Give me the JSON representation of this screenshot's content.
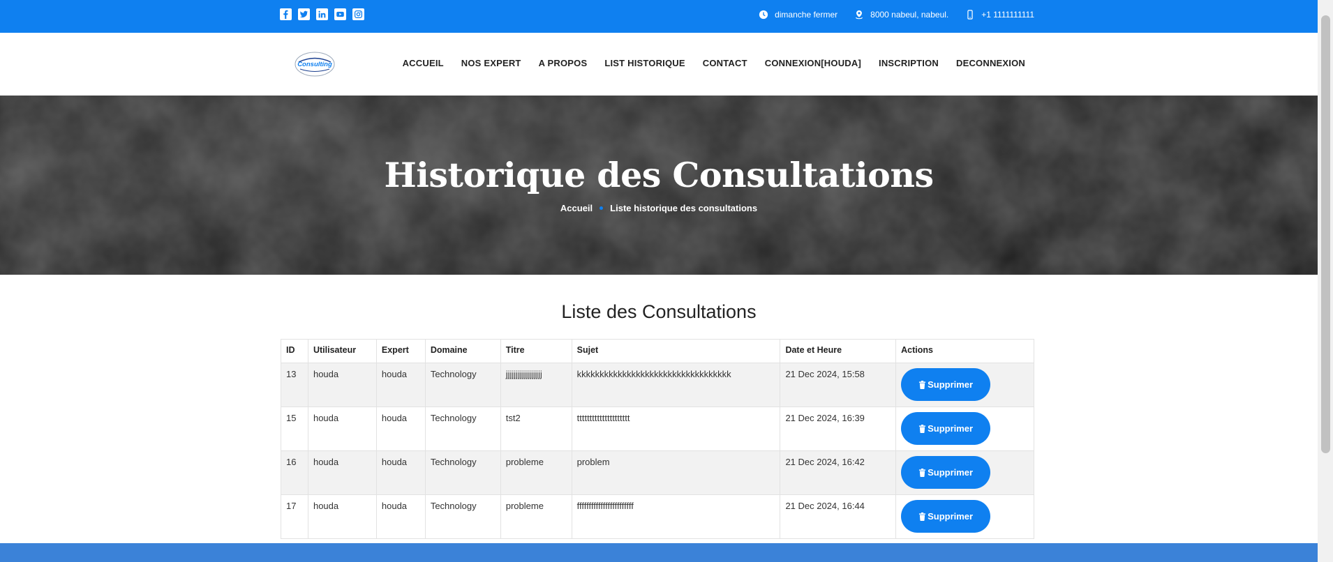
{
  "colors": {
    "accent": "#0f80f0",
    "hero_bg": "#262626",
    "footer": "#3b82d8"
  },
  "topbar": {
    "social_icons": [
      "facebook-icon",
      "twitter-icon",
      "linkedin-icon",
      "youtube-icon",
      "instagram-icon"
    ],
    "hours": "dimanche fermer",
    "address": "8000 nabeul, nabeul.",
    "phone": "+1 1111111111"
  },
  "logo": {
    "text": "Consulting"
  },
  "nav": {
    "items": [
      "ACCUEIL",
      "NOS EXPERT",
      "A PROPOS",
      "LIST HISTORIQUE",
      "CONTACT",
      "CONNEXION[HOUDA]",
      "INSCRIPTION",
      "DECONNEXION"
    ]
  },
  "hero": {
    "title": "Historique des Consultations",
    "breadcrumb_home": "Accueil",
    "breadcrumb_current": "Liste historique des consultations"
  },
  "list": {
    "title": "Liste des Consultations",
    "columns": [
      "ID",
      "Utilisateur",
      "Expert",
      "Domaine",
      "Titre",
      "Sujet",
      "Date et Heure",
      "Actions"
    ],
    "action_label": "Supprimer",
    "rows": [
      [
        "13",
        "houda",
        "houda",
        "Technology",
        "jjjjjjjjjjjjjjjjjj",
        "kkkkkkkkkkkkkkkkkkkkkkkkkkkkkkkkkk",
        "21 Dec 2024, 15:58"
      ],
      [
        "15",
        "houda",
        "houda",
        "Technology",
        "tst2",
        "ttttttttttttttttttttt",
        "21 Dec 2024, 16:39"
      ],
      [
        "16",
        "houda",
        "houda",
        "Technology",
        "probleme",
        "problem",
        "21 Dec 2024, 16:42"
      ],
      [
        "17",
        "houda",
        "houda",
        "Technology",
        "probleme",
        "ffffffffffffffffffffffff",
        "21 Dec 2024, 16:44"
      ]
    ]
  }
}
